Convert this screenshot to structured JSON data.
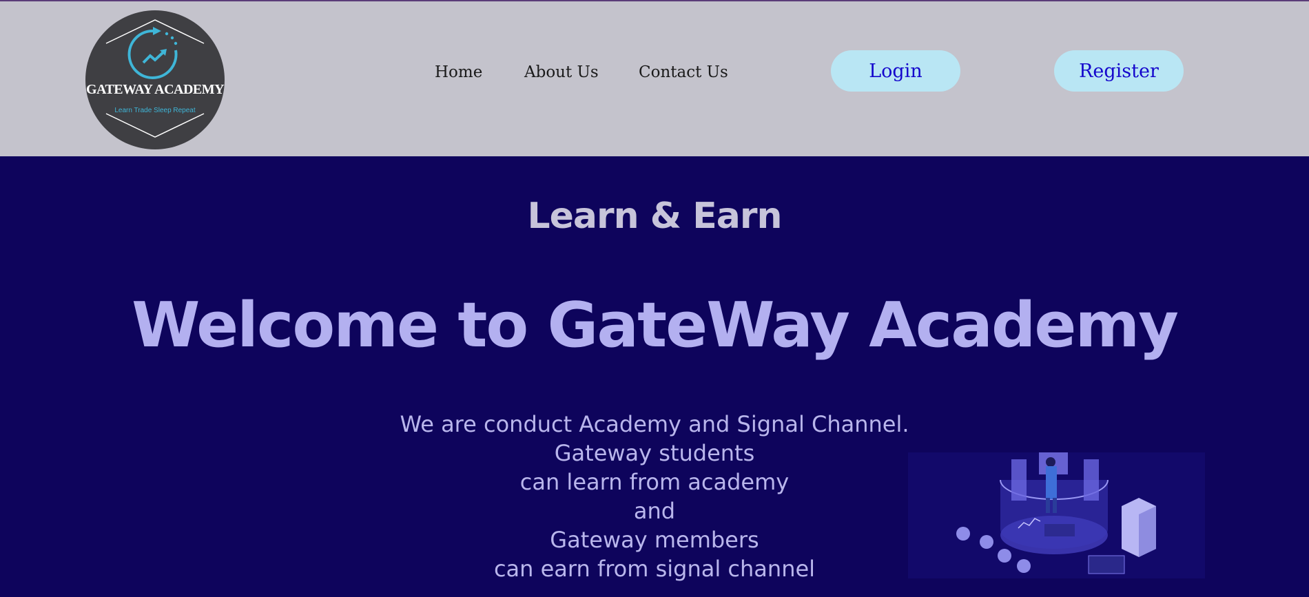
{
  "logo": {
    "title": "GATEWAY ACADEMY",
    "tagline": "Learn Trade Sleep Repeat"
  },
  "nav": {
    "home": "Home",
    "about": "About Us",
    "contact": "Contact Us",
    "login": "Login",
    "register": "Register"
  },
  "hero": {
    "subtitle": "Learn & Earn",
    "title": "Welcome to GateWay Academy",
    "lines": [
      "We are conduct Academy and Signal Channel.",
      "Gateway students",
      "can learn from academy",
      "and",
      "Gateway members",
      "can earn from signal channel"
    ]
  },
  "colors": {
    "header_bg": "#c4c3cc",
    "page_bg": "#0e045c",
    "button_bg": "#b9e6f4",
    "button_text": "#1406cc",
    "title_text": "#b3b0f0"
  },
  "icons": [
    "logo-growth-icon",
    "trading-illustration"
  ]
}
